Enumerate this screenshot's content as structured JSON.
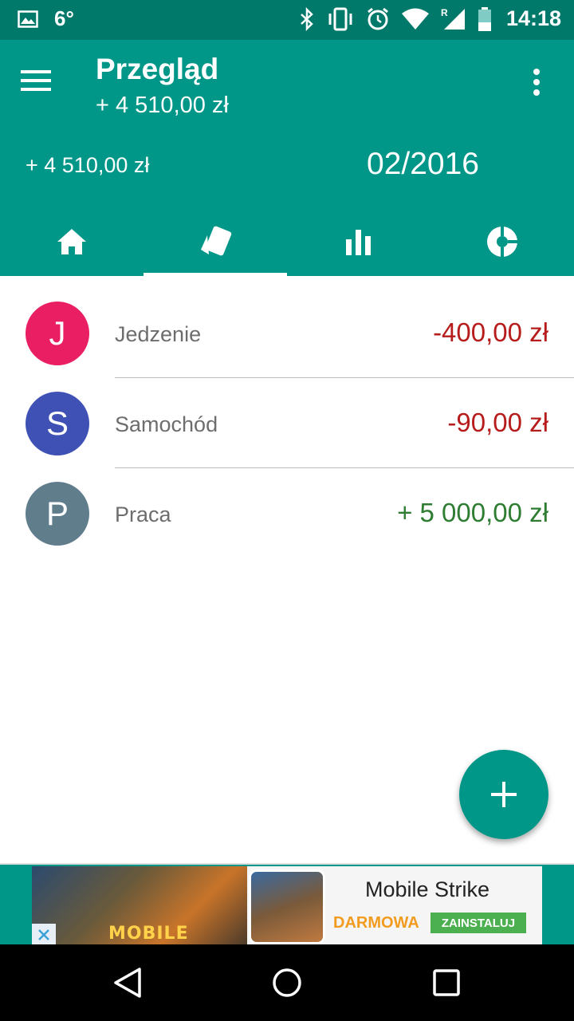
{
  "status_bar": {
    "temperature": "6°",
    "time": "14:18",
    "icons": [
      "image-icon",
      "bluetooth-icon",
      "vibrate-icon",
      "alarm-icon",
      "wifi-icon",
      "signal-icon",
      "battery-icon"
    ]
  },
  "app_bar": {
    "title": "Przegląd",
    "subtitle": "+ 4 510,00 zł",
    "summary_amount": "+ 4 510,00 zł",
    "period": "02/2016",
    "tabs": [
      {
        "icon": "home-icon",
        "active": false
      },
      {
        "icon": "cards-icon",
        "active": true
      },
      {
        "icon": "bar-chart-icon",
        "active": false
      },
      {
        "icon": "pie-chart-icon",
        "active": false
      }
    ]
  },
  "categories": [
    {
      "letter": "J",
      "label": "Jedzenie",
      "amount": "-400,00 zł",
      "avatar_color": "#e91e63",
      "amount_color": "#b71c1c"
    },
    {
      "letter": "S",
      "label": "Samochód",
      "amount": "-90,00 zł",
      "avatar_color": "#3f51b5",
      "amount_color": "#b71c1c"
    },
    {
      "letter": "P",
      "label": "Praca",
      "amount": "+ 5 000,00 zł",
      "avatar_color": "#607d8b",
      "amount_color": "#2e7d32"
    }
  ],
  "ad": {
    "banner_text": "MOBILE",
    "title": "Mobile Strike",
    "free_label": "DARMOWA",
    "install_label": "ZAINSTALUJ"
  },
  "colors": {
    "primary": "#009688",
    "primary_dark": "#00796b"
  }
}
